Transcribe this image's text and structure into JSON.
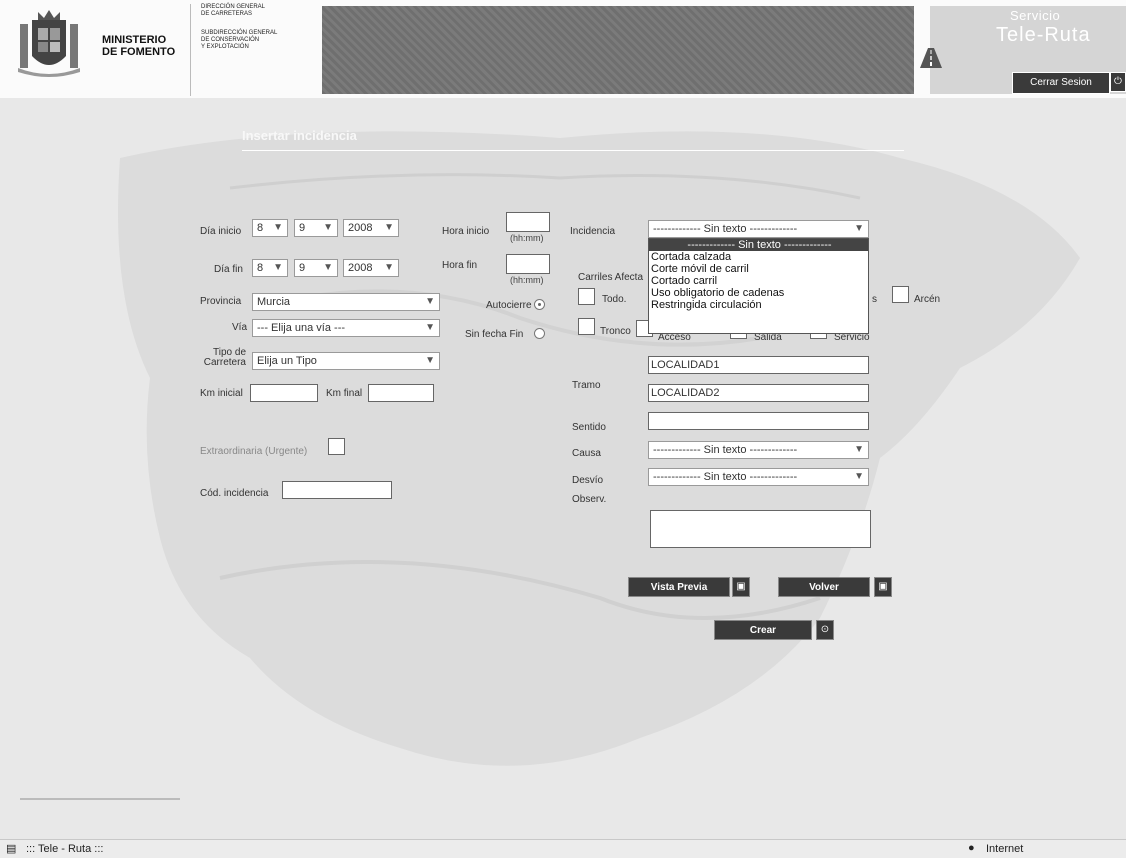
{
  "header": {
    "ministry": [
      "MINISTERIO",
      "DE FOMENTO"
    ],
    "dg": [
      "DIRECCIÓN GENERAL",
      "DE CARRETERAS"
    ],
    "sub": [
      "SUBDIRECCIÓN GENERAL",
      "DE CONSERVACIÓN",
      "Y EXPLOTACIÓN"
    ],
    "service_small": "Servicio",
    "service_big": "Tele-Ruta",
    "logout_label": "Cerrar Sesion"
  },
  "form": {
    "title": "Insertar incidencia",
    "dia_inicio_label": "Día inicio",
    "dia_fin_label": "Día fin",
    "dia_inicio": {
      "day": "8",
      "month": "9",
      "year": "2008"
    },
    "dia_fin": {
      "day": "8",
      "month": "9",
      "year": "2008"
    },
    "hora_inicio_label": "Hora inicio",
    "hora_fin_label": "Hora fin",
    "hhmm_hint": "(hh:mm)",
    "provincia_label": "Provincia",
    "provincia_value": "Murcia",
    "via_label": "Vía",
    "via_value": "--- Elija una vía ---",
    "tipo_label": [
      "Tipo de",
      "Carretera"
    ],
    "tipo_value": "Elija un Tipo",
    "km_inicial_label": "Km inicial",
    "km_final_label": "Km final",
    "autocierre_label": "Autocierre",
    "sin_fecha_fin_label": "Sin fecha Fin",
    "extraordinaria_label": "Extraordinaria (Urgente)",
    "cod_incidencia_label": "Cód. incidencia",
    "incidencia_label": "Incidencia",
    "incidencia_value": "------------- Sin texto -------------",
    "incidencia_options": [
      "------------- Sin texto -------------",
      "Cortada calzada",
      "Corte móvil de carril",
      "Cortado carril",
      "Uso obligatorio de cadenas",
      "Restringida circulación"
    ],
    "carriles_label": "Carriles Afecta",
    "carril_todo": "Todo.",
    "carril_arcen": "Arcén",
    "carril_partial": "s",
    "carril_tronco": "Tronco",
    "carril_acceso": "Acceso",
    "carril_salida": "Salida",
    "carril_servicio": "Servicio",
    "tramo_label": "Tramo",
    "tramo_1": "LOCALIDAD1",
    "tramo_2": "LOCALIDAD2",
    "sentido_label": "Sentido",
    "causa_label": "Causa",
    "causa_value": "------------- Sin texto -------------",
    "desvio_label": "Desvío",
    "desvio_value": "------------- Sin texto -------------",
    "observ_label": "Observ.",
    "vista_previa_label": "Vista Previa",
    "volver_label": "Volver",
    "crear_label": "Crear"
  },
  "status": {
    "page_title": "::: Tele - Ruta :::",
    "zone": "Internet"
  }
}
